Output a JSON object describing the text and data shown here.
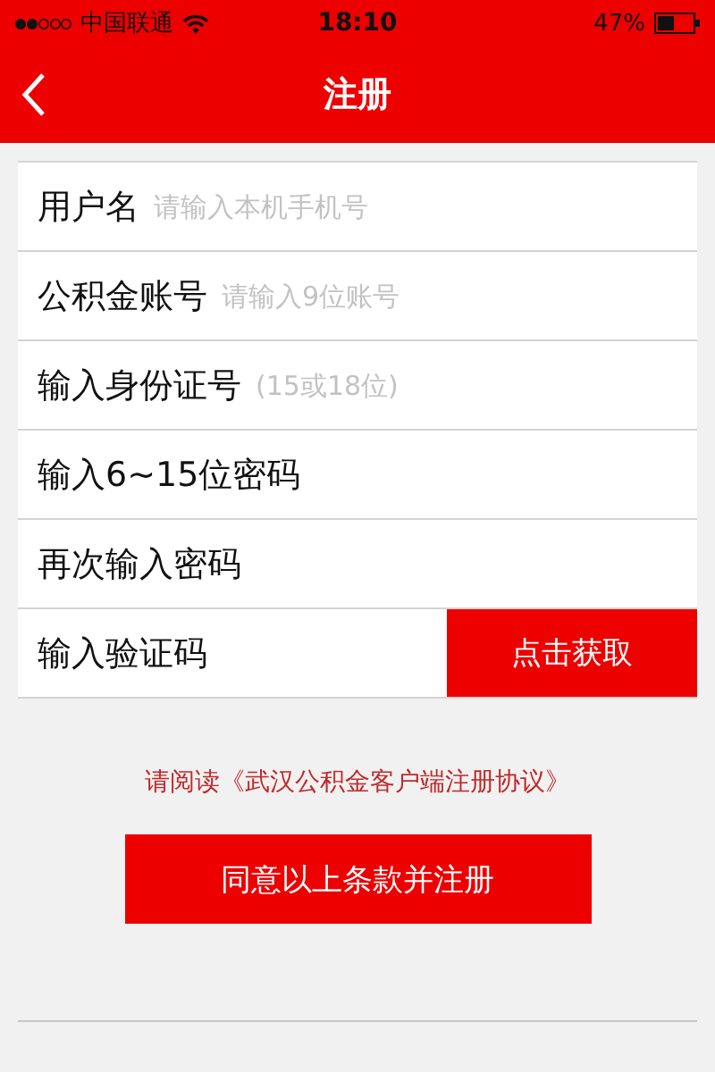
{
  "status_bar": {
    "carrier": "中国联通",
    "time": "18:10",
    "battery": "47%"
  },
  "nav": {
    "title": "注册"
  },
  "form": {
    "rows": [
      {
        "kind": "field",
        "label": "用户名",
        "placeholder": "请输入本机手机号"
      },
      {
        "kind": "field",
        "label": "公积金账号",
        "placeholder": "请输入9位账号"
      },
      {
        "kind": "field",
        "label": "输入身份证号",
        "placeholder": "(15或18位)"
      },
      {
        "kind": "field",
        "label": "输入6~15位密码"
      },
      {
        "kind": "field",
        "label": "再次输入密码"
      },
      {
        "kind": "code",
        "label": "输入验证码",
        "button": "点击获取"
      }
    ]
  },
  "agreement": "请阅读《武汉公积金客户端注册协议》",
  "submit": "同意以上条款并注册"
}
